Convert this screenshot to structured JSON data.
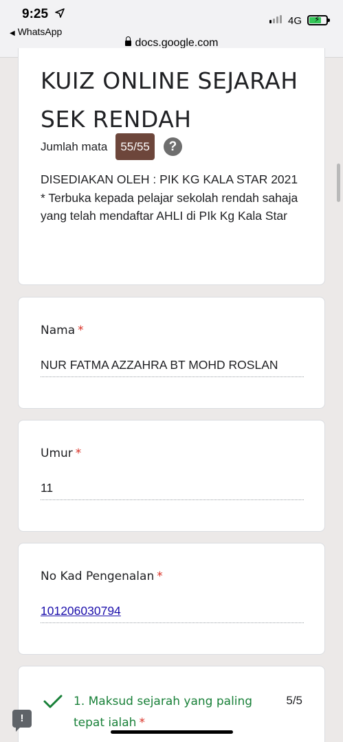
{
  "status_bar": {
    "time": "9:25",
    "back_app": "WhatsApp",
    "network": "4G",
    "signal_bars_active": 1
  },
  "browser": {
    "url": "docs.google.com"
  },
  "form": {
    "title": "KUIZ ONLINE SEJARAH SEK RENDAH",
    "score_label": "Jumlah mata",
    "score_value": "55/55",
    "description": "DISEDIAKAN OLEH : PIK KG KALA STAR 2021\n* Terbuka kepada pelajar sekolah rendah sahaja yang telah mendaftar AHLI di PIk Kg Kala Star"
  },
  "questions": [
    {
      "label": "Nama",
      "required": "*",
      "answer": "NUR FATMA AZZAHRA BT MOHD ROSLAN"
    },
    {
      "label": "Umur",
      "required": "*",
      "answer": "11"
    },
    {
      "label": "No Kad Pengenalan",
      "required": "*",
      "answer": "101206030794"
    }
  ],
  "quiz_question": {
    "text": "1. Maksud sejarah yang paling tepat ialah",
    "required": "*",
    "score": "5/5"
  },
  "colors": {
    "badge": "#6d463b",
    "correct": "#188038",
    "required": "#d93025",
    "link": "#1a0dab"
  },
  "icons": [
    "location-arrow-icon",
    "back-triangle-icon",
    "signal-icon",
    "battery-icon",
    "lock-icon",
    "help-icon",
    "check-icon",
    "feedback-icon"
  ]
}
